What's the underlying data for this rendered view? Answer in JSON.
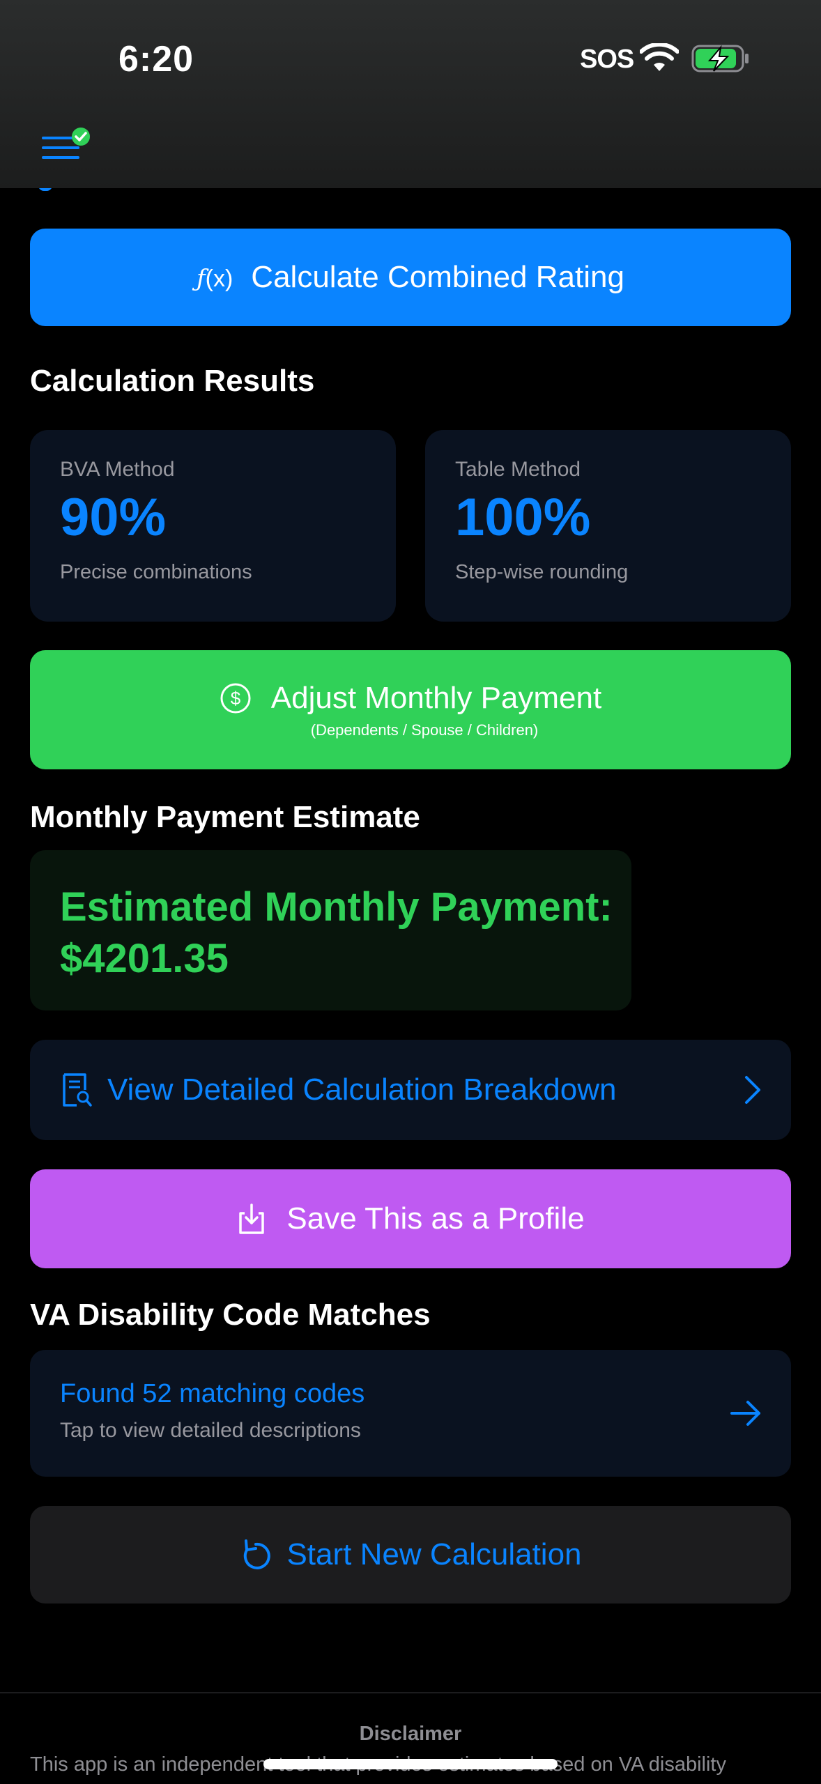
{
  "status_bar": {
    "time": "6:20",
    "carrier": "SOS"
  },
  "actions": {
    "calculate_label": "Calculate Combined Rating",
    "calculate_icon_text": "ƒ",
    "calculate_icon_args": "(x)"
  },
  "results": {
    "title": "Calculation Results",
    "bva": {
      "label": "BVA Method",
      "value": "90%",
      "sub": "Precise combinations"
    },
    "table": {
      "label": "Table Method",
      "value": "100%",
      "sub": "Step-wise rounding"
    }
  },
  "adjust": {
    "label": "Adjust Monthly Payment",
    "sub": "(Dependents / Spouse / Children)"
  },
  "payment": {
    "title": "Monthly Payment Estimate",
    "label": "Estimated Monthly Payment:",
    "amount": "$4201.35"
  },
  "breakdown": {
    "label": "View Detailed Calculation Breakdown"
  },
  "save": {
    "label": "Save This as a Profile"
  },
  "codes": {
    "title": "VA Disability Code Matches",
    "found": "Found 52 matching codes",
    "hint": "Tap to view detailed descriptions"
  },
  "new_calc": {
    "label": "Start New Calculation"
  },
  "footer": {
    "disclaimer_title": "Disclaimer",
    "disclaimer_text": "This app is an independent tool that provides estimates based on VA disability"
  },
  "colors": {
    "blue": "#0a84ff",
    "green": "#30d158",
    "purple": "#bf5af2",
    "card": "#0a1220",
    "background": "#000000"
  },
  "icons": {
    "menu": "menu-icon",
    "check": "checkmark-badge-icon",
    "function": "function-icon",
    "dollar": "dollar-circle-icon",
    "document": "document-search-icon",
    "chevron": "chevron-right-icon",
    "download": "save-download-icon",
    "arrow": "arrow-right-icon",
    "refresh": "refresh-icon"
  }
}
